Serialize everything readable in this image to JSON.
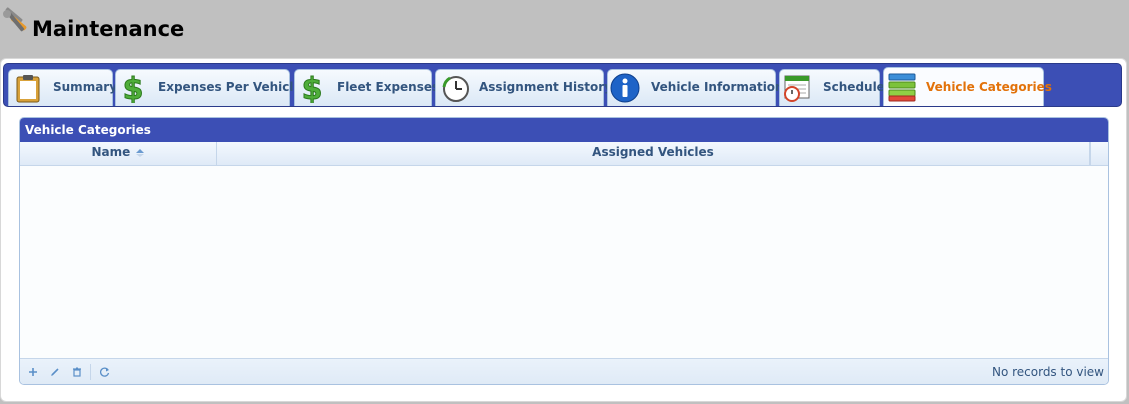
{
  "page": {
    "title": "Maintenance",
    "icon": "tools-icon"
  },
  "tabs": [
    {
      "label": "Summary",
      "icon": "clipboard-icon",
      "active": false
    },
    {
      "label": "Expenses Per Vehicle",
      "icon": "dollar-icon",
      "active": false
    },
    {
      "label": "Fleet Expenses",
      "icon": "dollar-icon",
      "active": false
    },
    {
      "label": "Assignment History",
      "icon": "clock-history-icon",
      "active": false
    },
    {
      "label": "Vehicle Information",
      "icon": "info-icon",
      "active": false
    },
    {
      "label": "Schedule",
      "icon": "calendar-clock-icon",
      "active": false
    },
    {
      "label": "Vehicle Categories",
      "icon": "categories-icon",
      "active": true
    }
  ],
  "grid": {
    "caption": "Vehicle Categories",
    "columns": [
      {
        "label": "Name",
        "sorted": "ascending"
      },
      {
        "label": "Assigned Vehicles"
      }
    ],
    "rows": [],
    "pager": {
      "buttons": [
        "add-icon",
        "edit-icon",
        "delete-icon",
        "refresh-icon"
      ],
      "info": "No records to view"
    }
  },
  "colors": {
    "accent_blue": "#3c4fb5",
    "active_tab_text": "#e2720a",
    "tab_text": "#33557f"
  }
}
